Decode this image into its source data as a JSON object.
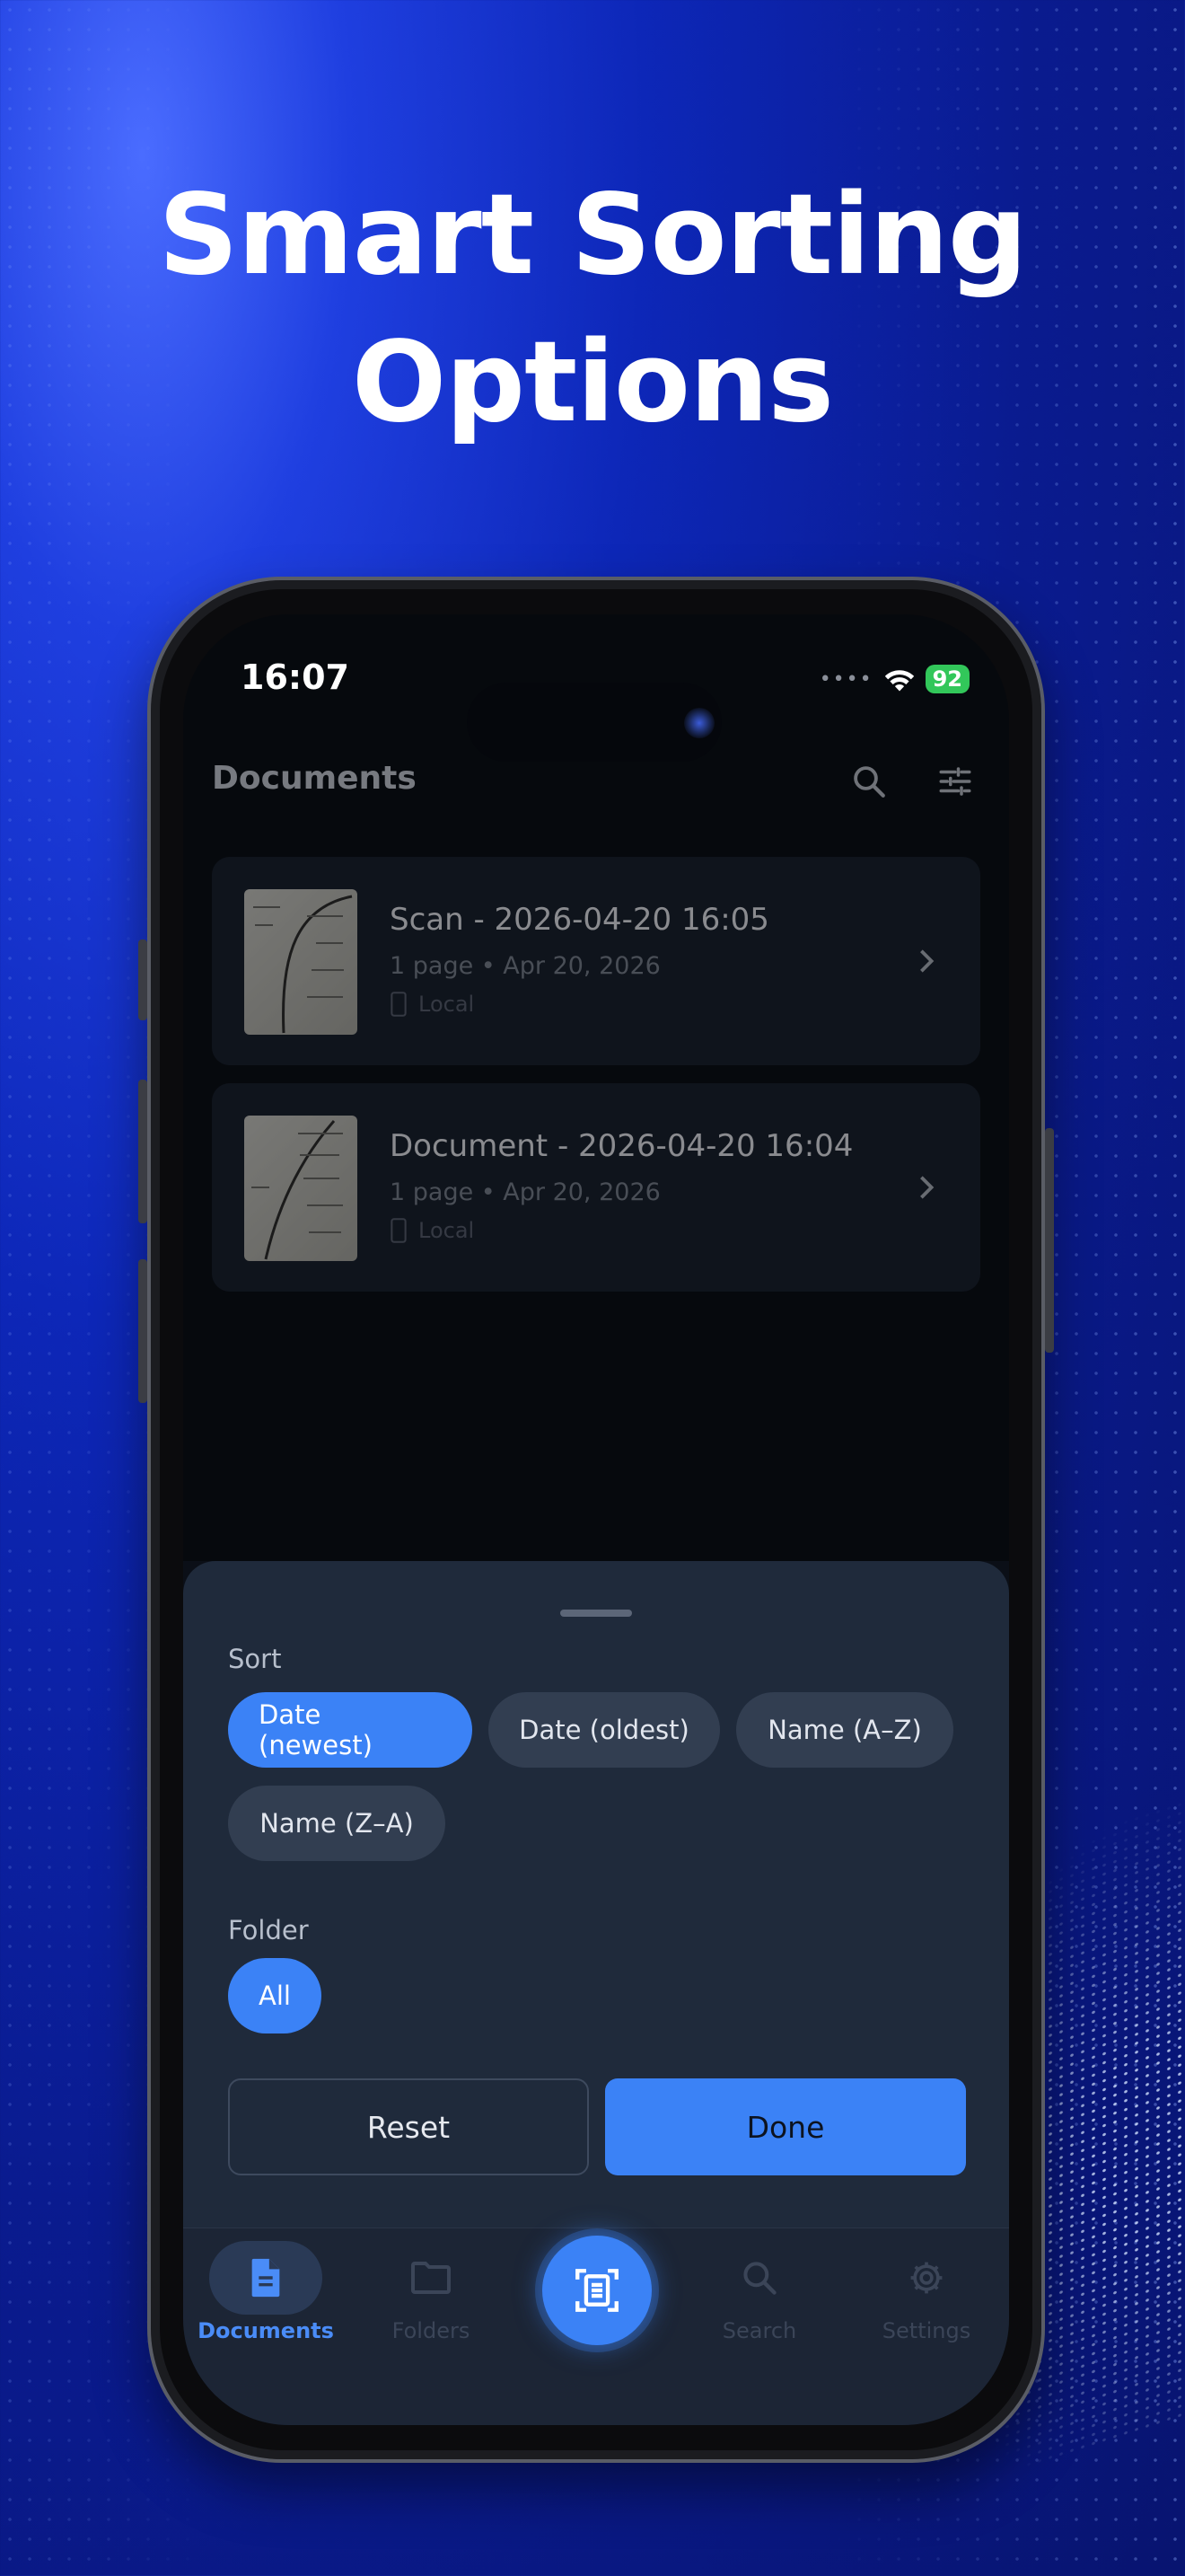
{
  "headline": {
    "line1": "Smart Sorting",
    "line2": "Options"
  },
  "status_bar": {
    "time": "16:07",
    "battery": "92"
  },
  "app_bar": {
    "title": "Documents",
    "search_icon": "search-icon",
    "filter_icon": "tune-icon"
  },
  "documents": [
    {
      "name": "Scan - 2026-04-20 16:05",
      "meta": "1 page • Apr 20, 2026",
      "location": "Local"
    },
    {
      "name": "Document - 2026-04-20 16:04",
      "meta": "1 page • Apr 20, 2026",
      "location": "Local"
    }
  ],
  "sheet": {
    "sort_label": "Sort",
    "sort_options": [
      "Date (newest)",
      "Date (oldest)",
      "Name (A–Z)",
      "Name (Z–A)"
    ],
    "sort_selected": "Date (newest)",
    "folder_label": "Folder",
    "folder_options": [
      "All"
    ],
    "folder_selected": "All",
    "reset_label": "Reset",
    "done_label": "Done"
  },
  "bottom_nav": {
    "items": [
      {
        "label": "Documents",
        "icon": "document-icon",
        "active": true
      },
      {
        "label": "Folders",
        "icon": "folder-icon",
        "active": false
      },
      {
        "label": "",
        "icon": "scan-icon",
        "active": false
      },
      {
        "label": "Search",
        "icon": "search-icon",
        "active": false
      },
      {
        "label": "Settings",
        "icon": "gear-icon",
        "active": false
      }
    ]
  },
  "colors": {
    "accent": "#3b82f6",
    "sheet_bg": "#1f2a3b",
    "battery": "#32c75a"
  }
}
